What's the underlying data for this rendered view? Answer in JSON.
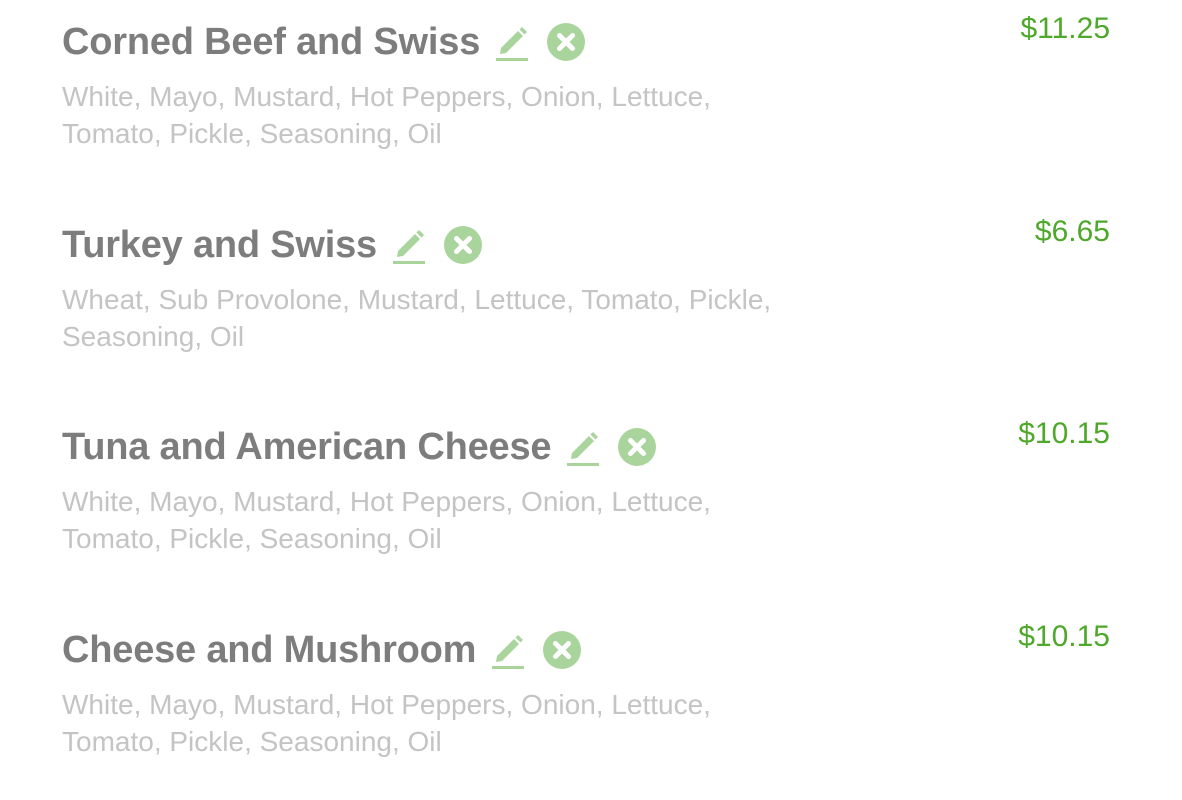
{
  "theme": {
    "accent": "#4ea82a",
    "icon_green": "#a9d49b",
    "name_color": "#7d7d7d",
    "desc_color": "#c4c4c4"
  },
  "order": {
    "items": [
      {
        "name": "Corned Beef and Swiss",
        "description": "White, Mayo, Mustard, Hot Peppers, Onion, Lettuce, Tomato, Pickle, Seasoning, Oil",
        "price": "$11.25",
        "edit_icon": "pencil-icon",
        "remove_icon": "remove-circle-icon"
      },
      {
        "name": "Turkey and Swiss",
        "description": "Wheat, Sub Provolone, Mustard, Lettuce, Tomato, Pickle, Seasoning, Oil",
        "price": "$6.65",
        "edit_icon": "pencil-icon",
        "remove_icon": "remove-circle-icon"
      },
      {
        "name": "Tuna and American Cheese",
        "description": "White, Mayo, Mustard, Hot Peppers, Onion, Lettuce, Tomato, Pickle, Seasoning, Oil",
        "price": "$10.15",
        "edit_icon": "pencil-icon",
        "remove_icon": "remove-circle-icon"
      },
      {
        "name": "Cheese and Mushroom",
        "description": "White, Mayo, Mustard, Hot Peppers, Onion, Lettuce, Tomato, Pickle, Seasoning, Oil",
        "price": "$10.15",
        "edit_icon": "pencil-icon",
        "remove_icon": "remove-circle-icon"
      }
    ]
  }
}
